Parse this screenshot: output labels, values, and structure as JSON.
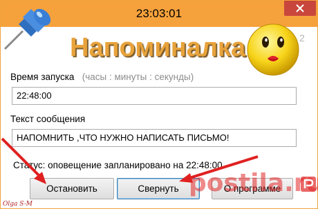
{
  "window": {
    "title": "23:03:01",
    "close_icon": "close-icon",
    "titlebar_color": "#f6a23c",
    "close_color": "#c9463d"
  },
  "header": {
    "app_title": "Напоминалка",
    "version": "2",
    "pin_icon": "pushpin-icon",
    "mascot_icon": "smiley-kiss-icon"
  },
  "form": {
    "start_time_label": "Время запуска",
    "start_time_hint": "(часы : минуты : секунды)",
    "start_time_value": "22:48:00",
    "message_label": "Текст сообщения",
    "message_value": "НАПОМНИТЬ ,ЧТО НУЖНО НАПИСАТЬ ПИСЬМО!"
  },
  "status": {
    "text": "Статус:  оповещение запланировано на 22:48:00"
  },
  "buttons": {
    "stop": "Остановить",
    "minimize": "Свернуть",
    "about": "О программе"
  },
  "overlay": {
    "watermark": "postila.ru",
    "signature": "Olga S-M",
    "arrow_color": "#e02020"
  }
}
